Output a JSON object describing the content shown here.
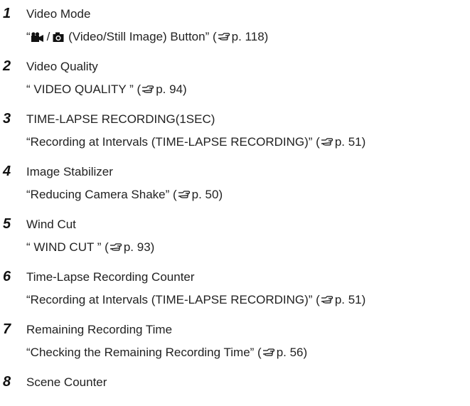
{
  "items": [
    {
      "number": "1",
      "title": "Video Mode",
      "ref_prefix": "“",
      "ref_text": " (Video/Still Image) Button” (",
      "ref_page": "p. 118)"
    },
    {
      "number": "2",
      "title": "Video Quality",
      "ref_text": "“ VIDEO QUALITY ” (",
      "ref_page": "p. 94)"
    },
    {
      "number": "3",
      "title": "TIME-LAPSE RECORDING(1SEC)",
      "ref_text": "“Recording at Intervals (TIME-LAPSE RECORDING)” (",
      "ref_page": "p. 51)"
    },
    {
      "number": "4",
      "title": "Image Stabilizer",
      "ref_text": "“Reducing Camera Shake” (",
      "ref_page": "p. 50)"
    },
    {
      "number": "5",
      "title": "Wind Cut",
      "ref_text": "“ WIND CUT ” (",
      "ref_page": "p. 93)"
    },
    {
      "number": "6",
      "title": "Time-Lapse Recording Counter",
      "ref_text": "“Recording at Intervals (TIME-LAPSE RECORDING)” (",
      "ref_page": "p. 51)"
    },
    {
      "number": "7",
      "title": "Remaining Recording Time",
      "ref_text": "“Checking the Remaining Recording Time” (",
      "ref_page": "p. 56)"
    },
    {
      "number": "8",
      "title": "Scene Counter"
    }
  ],
  "icons": {
    "video": "video-camera-icon",
    "still": "still-camera-icon",
    "ref": "pointing-hand-icon",
    "separator": "/"
  }
}
